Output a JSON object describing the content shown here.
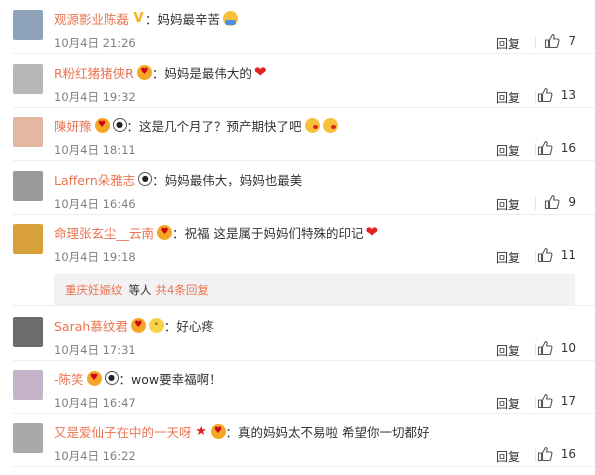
{
  "reply_label": "回复",
  "accent_color": "#eb7350",
  "comments": [
    {
      "user": "观源影业陈磊",
      "badges": [
        "verified-v-icon"
      ],
      "text": "妈妈最辛苦",
      "emoji": [
        "tired-face-emoji"
      ],
      "time": "10月4日 21:26",
      "likes": "7",
      "avatar_color": "#8ea2b9"
    },
    {
      "user": "R粉红猪猪侠R",
      "badges": [
        "fan-badge-icon"
      ],
      "text": "妈妈是最伟大的",
      "emoji": [
        "heart-emoji"
      ],
      "time": "10月4日 19:32",
      "likes": "13",
      "avatar_color": "#b7b7b7"
    },
    {
      "user": "陳妍豫",
      "badges": [
        "fan-badge-icon",
        "panda-icon"
      ],
      "text": "这是几个月了？预产期快了吧",
      "emoji": [
        "kiss-emoji",
        "kiss-emoji"
      ],
      "time": "10月4日 18:11",
      "likes": "16",
      "avatar_color": "#e2b8a0"
    },
    {
      "user": "Laffern朵雅志",
      "badges": [
        "panda-icon"
      ],
      "text": "妈妈最伟大，妈妈也最美",
      "emoji": [],
      "time": "10月4日 16:46",
      "likes": "9",
      "avatar_color": "#9a9a9a"
    },
    {
      "user": "命理张玄尘__云南",
      "badges": [
        "fan-badge-icon"
      ],
      "text": "祝福 这是属于妈妈们特殊的印记",
      "emoji": [
        "heart-emoji"
      ],
      "time": "10月4日 19:18",
      "likes": "11",
      "avatar_color": "#d9a13a"
    },
    {
      "user": "Sarah慕纹君",
      "badges": [
        "fan-badge-icon",
        "face-badge-icon"
      ],
      "text": "好心疼",
      "emoji": [],
      "time": "10月4日 17:31",
      "likes": "10",
      "avatar_color": "#6d6d6d"
    },
    {
      "user": "-陈笑",
      "badges": [
        "fan-badge-icon",
        "panda-icon"
      ],
      "text": "wow要幸福啊！",
      "emoji": [],
      "time": "10月4日 16:47",
      "likes": "17",
      "avatar_color": "#c5b3c9"
    },
    {
      "user": "又是爱仙子在中的一天呀",
      "badges": [
        "star-icon",
        "fan-badge-icon"
      ],
      "text": "真的妈妈太不易啦 希望你一切都好",
      "emoji": [],
      "time": "10月4日 16:22",
      "likes": "16",
      "avatar_color": "#a9a9a9"
    }
  ],
  "sub_reply": {
    "user": "重庆妊娠纹",
    "middle": "等人",
    "link": "共4条回复"
  }
}
